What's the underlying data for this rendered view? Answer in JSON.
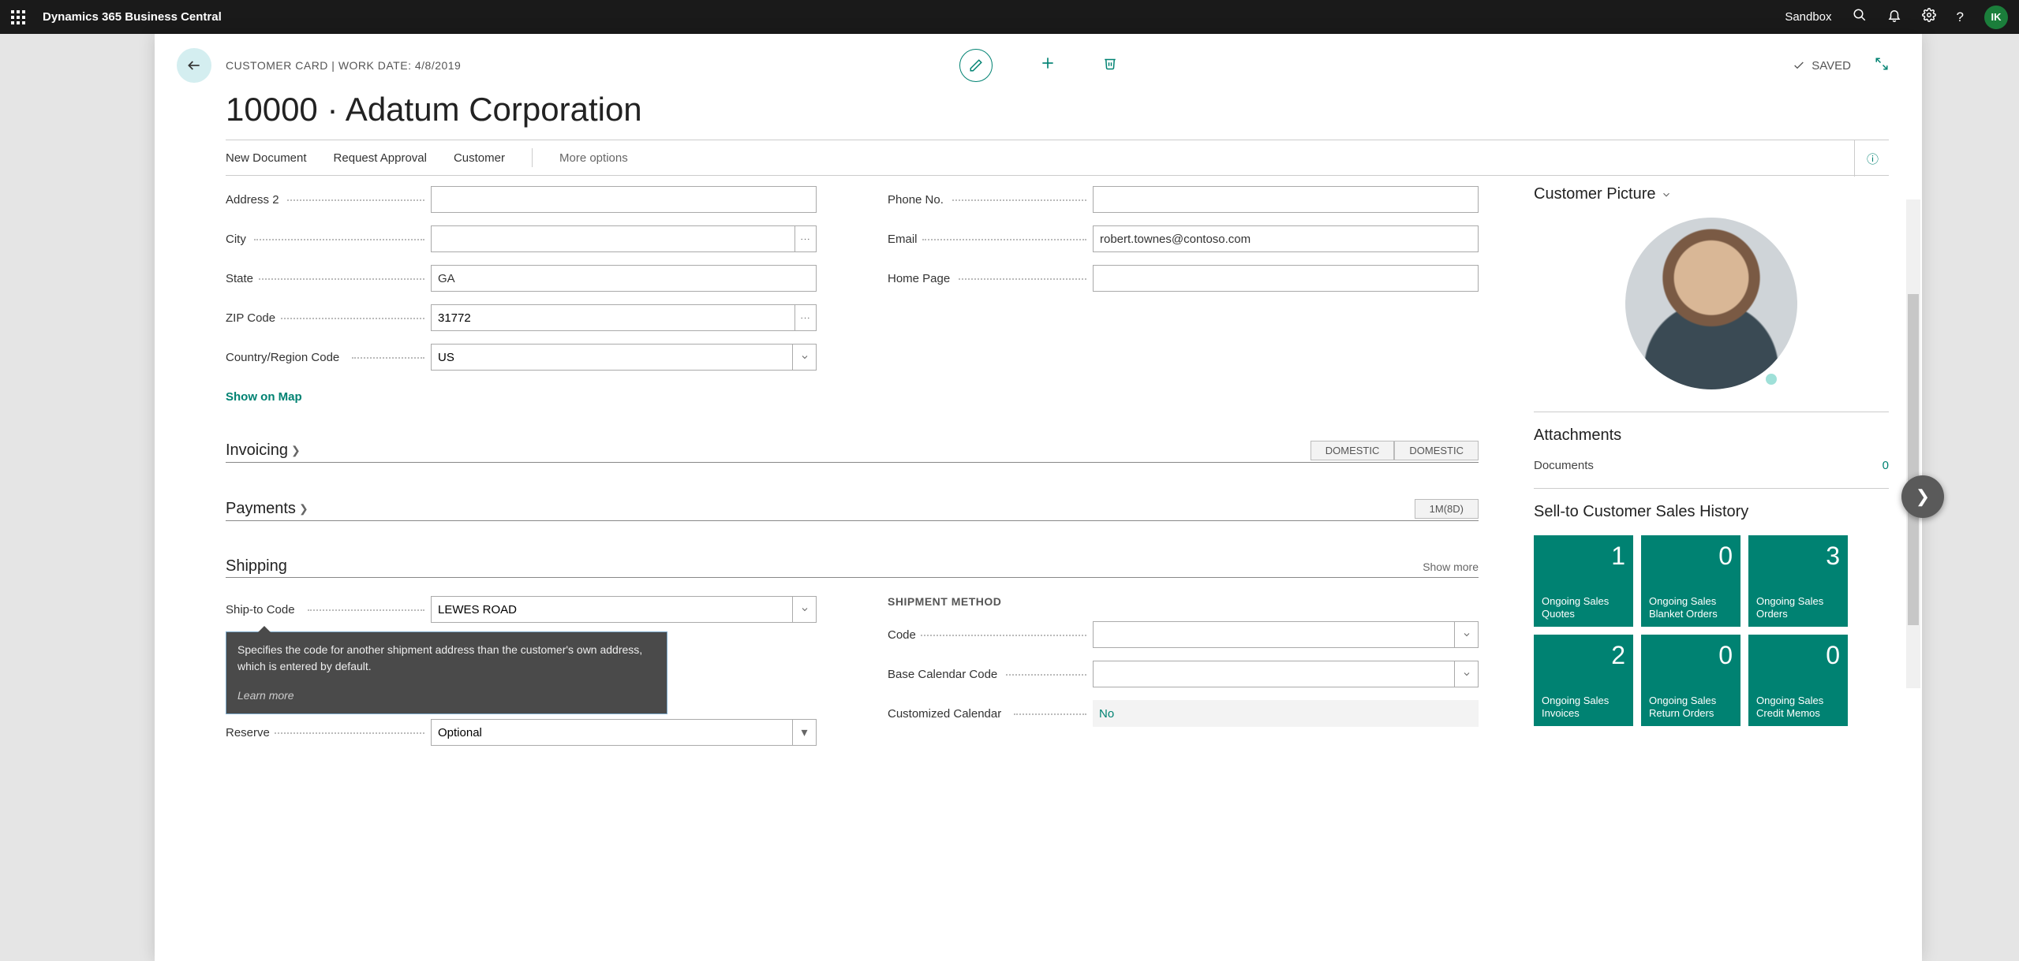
{
  "topbar": {
    "app_title": "Dynamics 365 Business Central",
    "env_label": "Sandbox",
    "avatar_initials": "IK"
  },
  "header": {
    "breadcrumb": "CUSTOMER CARD | WORK DATE: 4/8/2019",
    "saved_label": "SAVED"
  },
  "page_title": "10000 · Adatum Corporation",
  "action_bar": {
    "new_document": "New Document",
    "request_approval": "Request Approval",
    "customer": "Customer",
    "more_options": "More options"
  },
  "address_section": {
    "labels": {
      "address2": "Address 2",
      "city": "City",
      "state": "State",
      "zip": "ZIP Code",
      "country": "Country/Region Code",
      "phone": "Phone No.",
      "email": "Email",
      "homepage": "Home Page"
    },
    "values": {
      "address2": "",
      "city": "",
      "state": "GA",
      "zip": "31772",
      "country": "US",
      "phone": "",
      "email": "robert.townes@contoso.com",
      "homepage": ""
    },
    "show_on_map": "Show on Map"
  },
  "invoicing": {
    "title": "Invoicing",
    "tag1": "DOMESTIC",
    "tag2": "DOMESTIC"
  },
  "payments": {
    "title": "Payments",
    "tag": "1M(8D)"
  },
  "shipping": {
    "title": "Shipping",
    "show_more": "Show more",
    "left": {
      "ship_to_code_label": "Ship-to Code",
      "ship_to_code_value": "LEWES ROAD",
      "reserve_label": "Reserve",
      "reserve_value": "Optional"
    },
    "tooltip": {
      "text": "Specifies the code for another shipment address than the customer's own address, which is entered by default.",
      "learn_more": "Learn more"
    },
    "right": {
      "shipment_method_heading": "SHIPMENT METHOD",
      "code_label": "Code",
      "code_value": "",
      "base_cal_label": "Base Calendar Code",
      "base_cal_value": "",
      "cust_cal_label": "Customized Calendar",
      "cust_cal_value": "No"
    }
  },
  "side": {
    "customer_picture": "Customer Picture",
    "attachments_title": "Attachments",
    "documents_label": "Documents",
    "documents_count": "0",
    "history_title": "Sell-to Customer Sales History",
    "tiles1": [
      {
        "n": "1",
        "lbl": "Ongoing Sales Quotes"
      },
      {
        "n": "0",
        "lbl": "Ongoing Sales Blanket Orders"
      },
      {
        "n": "3",
        "lbl": "Ongoing Sales Orders"
      }
    ],
    "tiles2": [
      {
        "n": "2",
        "lbl": "Ongoing Sales Invoices"
      },
      {
        "n": "0",
        "lbl": "Ongoing Sales Return Orders"
      },
      {
        "n": "0",
        "lbl": "Ongoing Sales Credit Memos"
      }
    ]
  }
}
